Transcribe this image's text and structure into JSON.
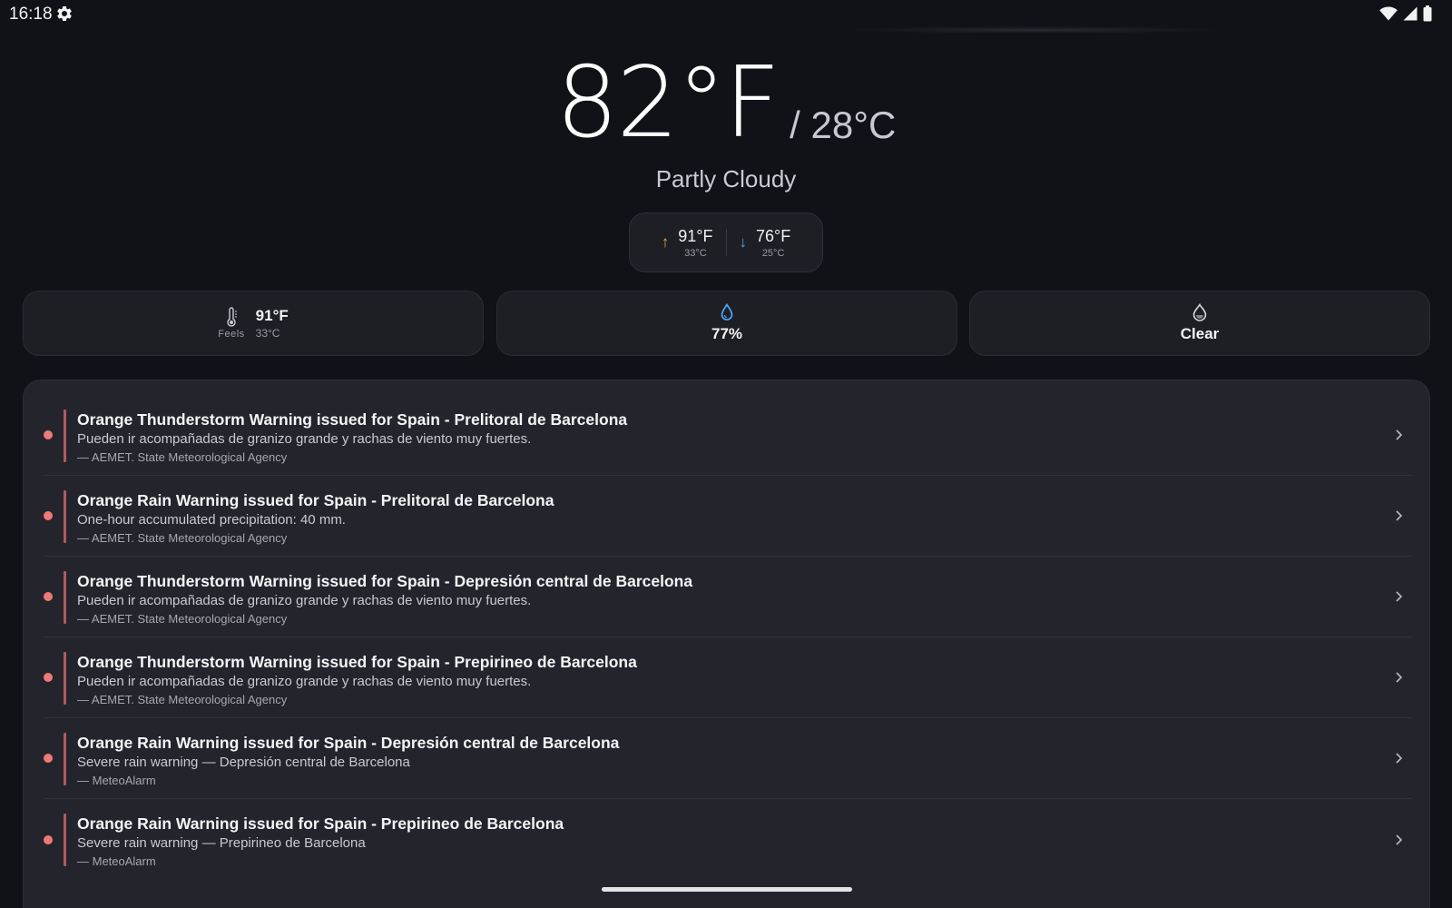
{
  "status_bar": {
    "time": "16:18",
    "icons": [
      "settings-icon",
      "wifi-icon",
      "signal-icon",
      "battery-icon"
    ]
  },
  "current": {
    "temp_f": "82°F",
    "temp_c": "/ 28°C",
    "condition": "Partly Cloudy"
  },
  "hilo": {
    "high_f": "91°F",
    "high_c": "33°C",
    "low_f": "76°F",
    "low_c": "25°C",
    "high_arrow": "↑",
    "low_arrow": "↓"
  },
  "cards": {
    "feels": {
      "label": "Feels",
      "value_f": "91°F",
      "value_c": "33°C",
      "icon": "thermometer-icon"
    },
    "humidity": {
      "value": "77%",
      "icon": "water-drop-icon"
    },
    "precip": {
      "value": "Clear",
      "icon": "precipitation-drop-icon"
    }
  },
  "alerts": [
    {
      "title": "Orange Thunderstorm Warning issued for Spain - Prelitoral de Barcelona",
      "description": "Pueden ir acompañadas de granizo grande y rachas de viento muy fuertes.",
      "source": "— AEMET. State Meteorological Agency"
    },
    {
      "title": "Orange Rain Warning issued for Spain - Prelitoral de Barcelona",
      "description": "One-hour accumulated precipitation: 40 mm.",
      "source": "— AEMET. State Meteorological Agency"
    },
    {
      "title": "Orange Thunderstorm Warning issued for Spain - Depresión central de Barcelona",
      "description": "Pueden ir acompañadas de granizo grande y rachas de viento muy fuertes.",
      "source": "— AEMET. State Meteorological Agency"
    },
    {
      "title": "Orange Thunderstorm Warning issued for Spain - Prepirineo de Barcelona",
      "description": "Pueden ir acompañadas de granizo grande y rachas de viento muy fuertes.",
      "source": "— AEMET. State Meteorological Agency"
    },
    {
      "title": "Orange Rain Warning issued for Spain - Depresión central de Barcelona",
      "description": "Severe rain warning — Depresión central de Barcelona",
      "source": "— MeteoAlarm"
    },
    {
      "title": "Orange Rain Warning issued for Spain - Prepirineo de Barcelona",
      "description": "Severe rain warning — Prepirineo de Barcelona",
      "source": "— MeteoAlarm"
    }
  ],
  "colors": {
    "background": "#111217",
    "card": "#1e1f25",
    "panel": "#24252c",
    "alert_dot": "#f17878",
    "alert_bar": "#b35a5e",
    "high_arrow": "#f0a94a",
    "low_arrow": "#4aa3f0",
    "humidity_icon": "#4aa3f0"
  }
}
